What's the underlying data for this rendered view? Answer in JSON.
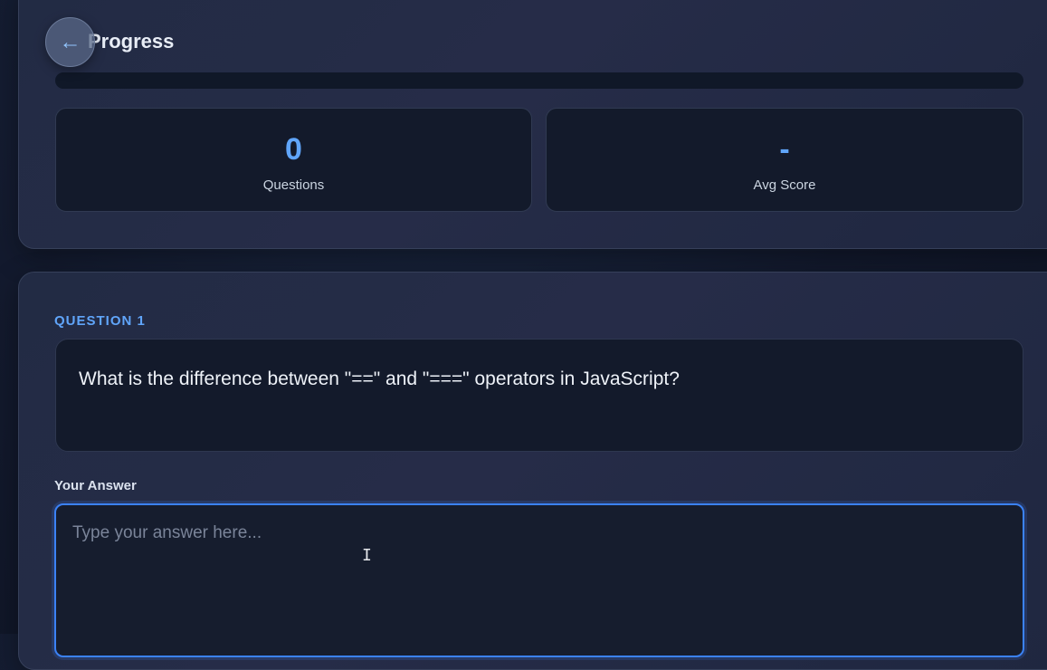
{
  "progress": {
    "title": "Progress",
    "back_icon": "←",
    "fill_percent": 0,
    "stats": [
      {
        "value": "0",
        "label": "Questions"
      },
      {
        "value": "-",
        "label": "Avg Score"
      }
    ]
  },
  "question": {
    "label": "QUESTION 1",
    "text": "What is the difference between \"==\" and \"===\" operators in JavaScript?"
  },
  "answer": {
    "label": "Your Answer",
    "value": "",
    "placeholder": "Type your answer here..."
  },
  "colors": {
    "accent": "#60a5fa",
    "focus_border": "#3b82f6",
    "card_bg": "#131a2b"
  },
  "icons": {
    "back": "arrow-left-icon",
    "cursor": "text-cursor-icon"
  }
}
